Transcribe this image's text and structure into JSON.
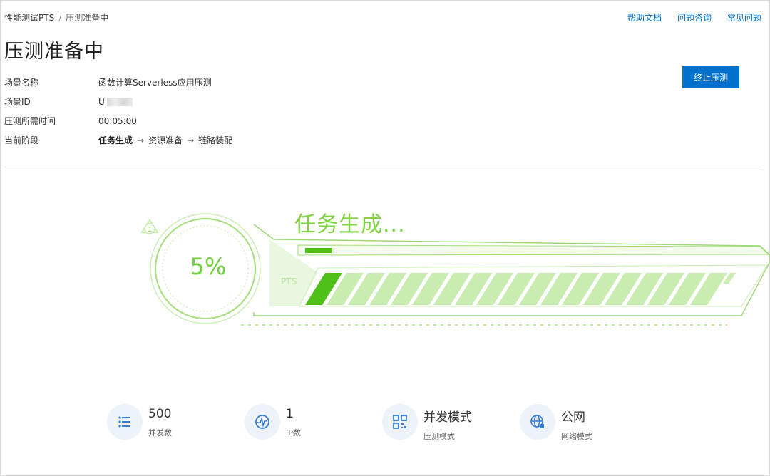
{
  "breadcrumb": {
    "root": "性能测试PTS",
    "separator": "/",
    "current": "压测准备中"
  },
  "top_links": [
    "帮助文档",
    "问题咨询",
    "常见问题"
  ],
  "page_title": "压测准备中",
  "info": {
    "scene_name_label": "场景名称",
    "scene_name_value": "函数计算Serverless应用压测",
    "scene_id_label": "场景ID",
    "scene_id_value": "U",
    "duration_label": "压测所需时间",
    "duration_value": "00:05:00",
    "stage_label": "当前阶段",
    "stages": [
      "任务生成",
      "资源准备",
      "链路装配"
    ],
    "stage_arrow": "→"
  },
  "stop_button": "终止压测",
  "progress": {
    "percent_text": "5%",
    "percent_value": 5,
    "task_title": "任务生成...",
    "pts_label": "PTS",
    "step_badge": "1",
    "color_primary": "#52c41a",
    "color_light": "#c9edb0"
  },
  "stats": [
    {
      "value": "500",
      "label": "并发数",
      "icon": "list-icon"
    },
    {
      "value": "1",
      "label": "IP数",
      "icon": "pulse-icon"
    },
    {
      "value": "并发模式",
      "label": "压测模式",
      "icon": "qr-grid-icon"
    },
    {
      "value": "公网",
      "label": "网络模式",
      "icon": "globe-icon"
    }
  ],
  "colors": {
    "accent": "#0070cc",
    "progress_green": "#6fcf3d"
  }
}
